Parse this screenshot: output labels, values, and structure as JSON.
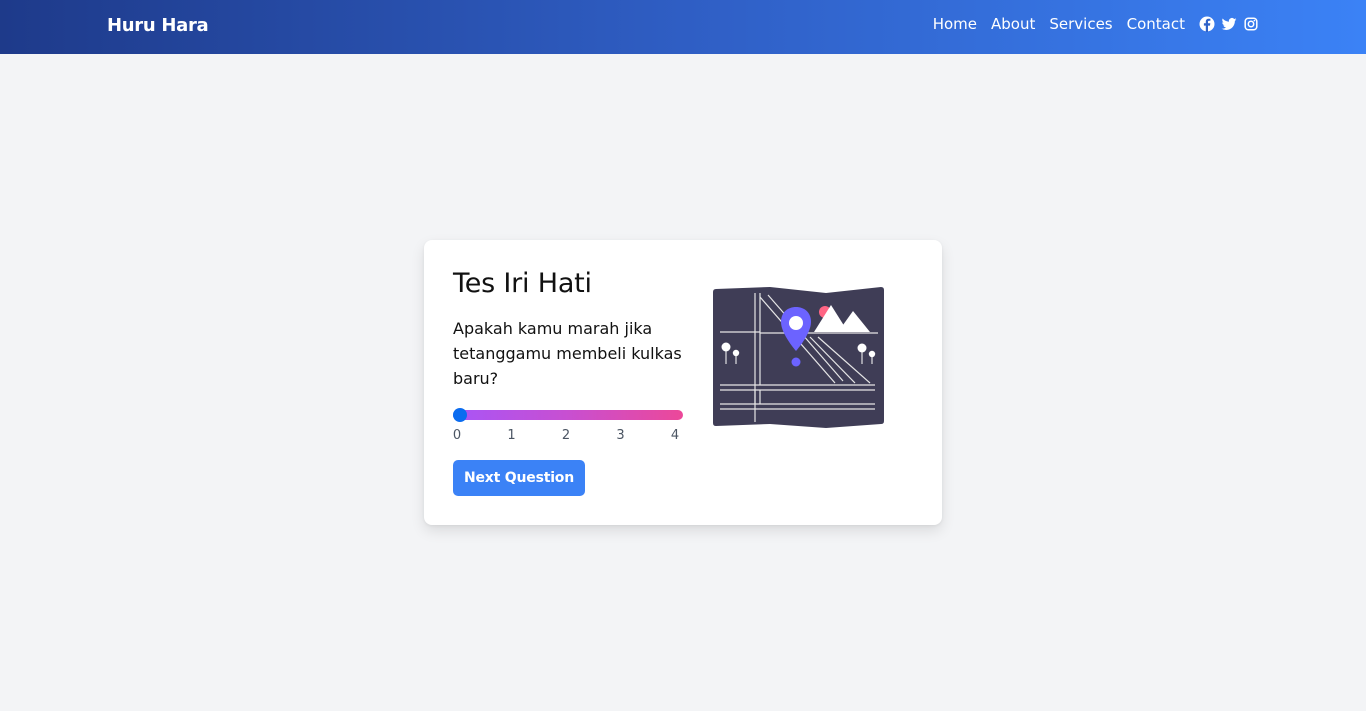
{
  "navbar": {
    "brand": "Huru Hara",
    "links": [
      "Home",
      "About",
      "Services",
      "Contact"
    ],
    "social": [
      "facebook-icon",
      "twitter-icon",
      "instagram-icon"
    ]
  },
  "quiz": {
    "title": "Tes Iri Hati",
    "question": "Apakah kamu marah jika tetanggamu membeli kulkas baru?",
    "slider": {
      "value": 0,
      "min": 0,
      "max": 4,
      "ticks": [
        "0",
        "1",
        "2",
        "3",
        "4"
      ]
    },
    "next_label": "Next Question"
  },
  "colors": {
    "nav_gradient_start": "#1e3a8a",
    "nav_gradient_end": "#3b82f6",
    "button": "#3b82f6",
    "slider_start": "#a855f7",
    "slider_end": "#ec4899",
    "thumb": "#0b6cf0",
    "map": "#3f3d56",
    "pin": "#6c63ff"
  }
}
